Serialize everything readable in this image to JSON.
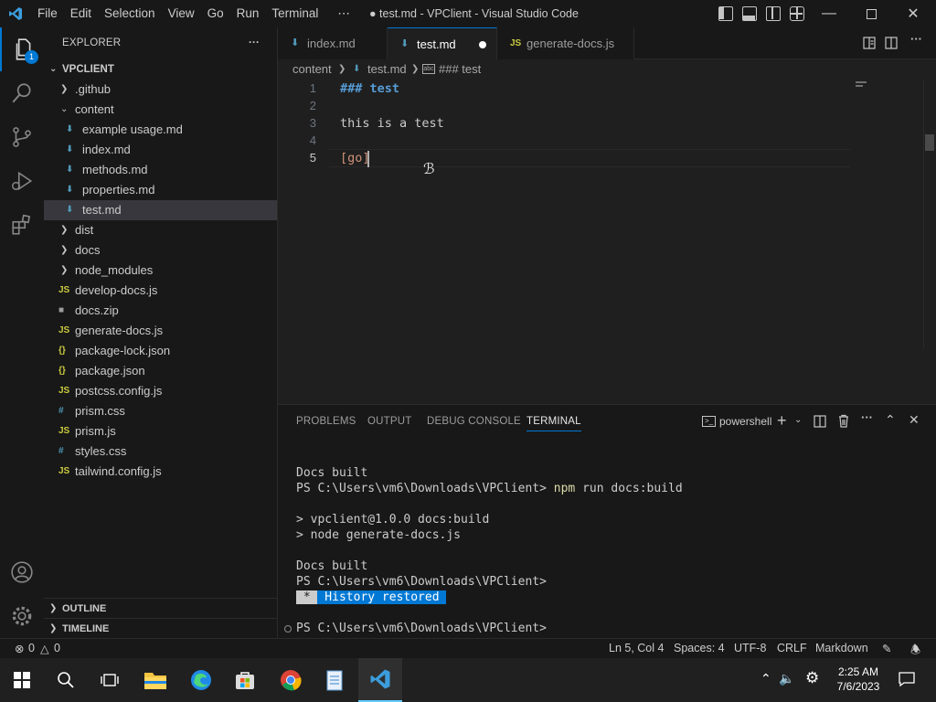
{
  "titlebar": {
    "menus": [
      "File",
      "Edit",
      "Selection",
      "View",
      "Go",
      "Run",
      "Terminal",
      "⋯"
    ],
    "window_title": "● test.md - VPClient - Visual Studio Code"
  },
  "activity": {
    "explorer_badge": "1"
  },
  "sidebar": {
    "title": "EXPLORER",
    "more": "···",
    "root": "VPCLIENT",
    "items": [
      {
        "label": ".github",
        "type": "folder",
        "expanded": false
      },
      {
        "label": "content",
        "type": "folder",
        "expanded": true
      },
      {
        "label": "example usage.md",
        "type": "md"
      },
      {
        "label": "index.md",
        "type": "md"
      },
      {
        "label": "methods.md",
        "type": "md"
      },
      {
        "label": "properties.md",
        "type": "md"
      },
      {
        "label": "test.md",
        "type": "md",
        "selected": true
      },
      {
        "label": "dist",
        "type": "folder",
        "expanded": false
      },
      {
        "label": "docs",
        "type": "folder",
        "expanded": false
      },
      {
        "label": "node_modules",
        "type": "folder",
        "expanded": false
      },
      {
        "label": "develop-docs.js",
        "type": "js"
      },
      {
        "label": "docs.zip",
        "type": "zip"
      },
      {
        "label": "generate-docs.js",
        "type": "js"
      },
      {
        "label": "package-lock.json",
        "type": "json"
      },
      {
        "label": "package.json",
        "type": "json"
      },
      {
        "label": "postcss.config.js",
        "type": "js"
      },
      {
        "label": "prism.css",
        "type": "css"
      },
      {
        "label": "prism.js",
        "type": "js"
      },
      {
        "label": "styles.css",
        "type": "css"
      },
      {
        "label": "tailwind.config.js",
        "type": "js"
      }
    ],
    "outline": "OUTLINE",
    "timeline": "TIMELINE"
  },
  "tabs": [
    {
      "label": "index.md",
      "active": false
    },
    {
      "label": "test.md",
      "active": true,
      "dirty": true
    },
    {
      "label": "generate-docs.js",
      "active": false
    }
  ],
  "breadcrumb": {
    "folder": "content",
    "file": "test.md",
    "symbol": "### test"
  },
  "editor": {
    "lines": [
      {
        "num": "1",
        "text": "### test"
      },
      {
        "num": "2",
        "text": ""
      },
      {
        "num": "3",
        "text": "this is a test"
      },
      {
        "num": "4",
        "text": ""
      },
      {
        "num": "5",
        "text": "[go]"
      }
    ]
  },
  "panel": {
    "tabs": [
      "PROBLEMS",
      "OUTPUT",
      "DEBUG CONSOLE",
      "TERMINAL"
    ],
    "shell": "powershell",
    "terminal": {
      "l1": "Docs built",
      "l2_prefix": "PS C:\\Users\\vm6\\Downloads\\VPClient> ",
      "l2_cmd": "npm",
      "l2_rest": " run docs:build",
      "l3": "> vpclient@1.0.0 docs:build",
      "l4": "> node generate-docs.js",
      "l5": "Docs built",
      "l6": "PS C:\\Users\\vm6\\Downloads\\VPClient>",
      "restored_star": " * ",
      "restored": " History restored ",
      "l8": "PS C:\\Users\\vm6\\Downloads\\VPClient>"
    }
  },
  "statusbar": {
    "errors": "0",
    "warnings": "0",
    "position": "Ln 5, Col 4",
    "spaces": "Spaces: 4",
    "encoding": "UTF-8",
    "eol": "CRLF",
    "language": "Markdown"
  },
  "taskbar": {
    "time": "2:25 AM",
    "date": "7/6/2023"
  },
  "colors": {
    "accent": "#0078d4",
    "md_icon": "#519aba",
    "js_icon": "#cbcb41",
    "json_icon": "#cbcb41",
    "css_icon": "#519aba",
    "heading": "#569cd6"
  }
}
